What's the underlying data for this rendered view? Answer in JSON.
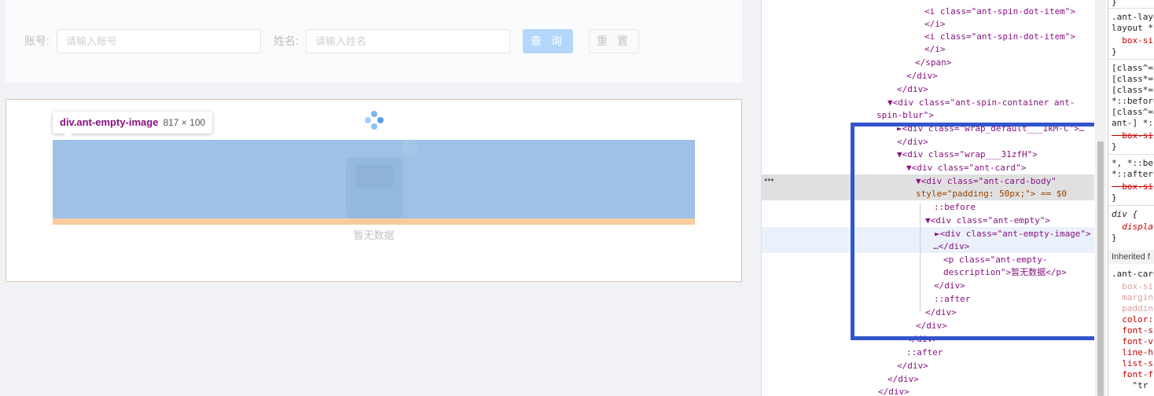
{
  "form": {
    "account_label": "账号:",
    "account_placeholder": "请输入账号",
    "name_label": "姓名:",
    "name_placeholder": "请输入姓名",
    "search_button": "查 询",
    "reset_button": "重 置"
  },
  "result": {
    "empty_description": "暂无数据"
  },
  "tooltip": {
    "selector": "div.ant-empty-image",
    "dimensions": "817 × 100"
  },
  "devtools": {
    "lines": [
      "<i class=\"ant-spin-dot-item\">",
      "</i>",
      "<i class=\"ant-spin-dot-item\">",
      "</i>",
      "</span>",
      "</div>",
      "</div>",
      "▼<div class=\"ant-spin-container ant-",
      "spin-blur\">",
      "►<div class=\"wrap_default___1kM-C\">…",
      "</div>",
      "▼<div class=\"wrap___31zfH\">",
      "▼<div class=\"ant-card\">",
      "▼<div class=\"ant-card-body\"",
      "style=\"padding: 50px;\"> == $0",
      "::before",
      "▼<div class=\"ant-empty\">",
      "►<div class=\"ant-empty-image\">",
      "…</div>",
      "<p class=\"ant-empty-",
      "description\">暂无数据</p>",
      "</div>",
      "::after",
      "</div>",
      "</div>",
      "</div>",
      "::after",
      "</div>",
      "</div>",
      "</div>"
    ],
    "styles": [
      "}",
      ".ant-layo",
      "layout *",
      "  box-si",
      "}",
      "[class^=a",
      "[class*=",
      "[class*=",
      "*::before",
      "[class^=a",
      "ant-] *:",
      "  box-si",
      "}",
      "*, *::bef",
      "*::after",
      "  box-si",
      "}",
      "div {",
      "  displa",
      "}",
      "Inherited f",
      ".ant-card",
      "  box-si",
      "  margin",
      "  paddin",
      "  color:",
      "  font-s",
      "  font-v",
      "  line-h",
      "  list-s",
      "  font-f",
      "    \"tr"
    ]
  }
}
